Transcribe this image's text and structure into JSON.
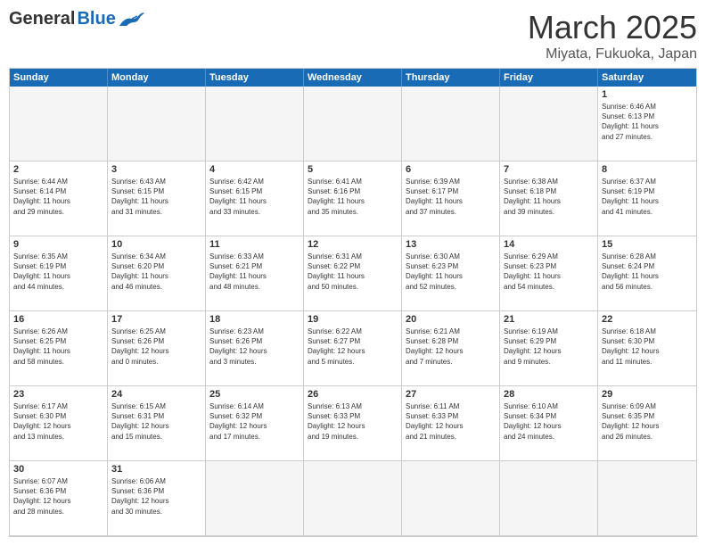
{
  "header": {
    "logo_general": "General",
    "logo_blue": "Blue",
    "title": "March 2025",
    "subtitle": "Miyata, Fukuoka, Japan"
  },
  "weekdays": [
    "Sunday",
    "Monday",
    "Tuesday",
    "Wednesday",
    "Thursday",
    "Friday",
    "Saturday"
  ],
  "weeks": [
    [
      {
        "day": "",
        "text": ""
      },
      {
        "day": "",
        "text": ""
      },
      {
        "day": "",
        "text": ""
      },
      {
        "day": "",
        "text": ""
      },
      {
        "day": "",
        "text": ""
      },
      {
        "day": "",
        "text": ""
      },
      {
        "day": "1",
        "text": "Sunrise: 6:46 AM\nSunset: 6:13 PM\nDaylight: 11 hours\nand 27 minutes."
      }
    ],
    [
      {
        "day": "2",
        "text": "Sunrise: 6:44 AM\nSunset: 6:14 PM\nDaylight: 11 hours\nand 29 minutes."
      },
      {
        "day": "3",
        "text": "Sunrise: 6:43 AM\nSunset: 6:15 PM\nDaylight: 11 hours\nand 31 minutes."
      },
      {
        "day": "4",
        "text": "Sunrise: 6:42 AM\nSunset: 6:15 PM\nDaylight: 11 hours\nand 33 minutes."
      },
      {
        "day": "5",
        "text": "Sunrise: 6:41 AM\nSunset: 6:16 PM\nDaylight: 11 hours\nand 35 minutes."
      },
      {
        "day": "6",
        "text": "Sunrise: 6:39 AM\nSunset: 6:17 PM\nDaylight: 11 hours\nand 37 minutes."
      },
      {
        "day": "7",
        "text": "Sunrise: 6:38 AM\nSunset: 6:18 PM\nDaylight: 11 hours\nand 39 minutes."
      },
      {
        "day": "8",
        "text": "Sunrise: 6:37 AM\nSunset: 6:19 PM\nDaylight: 11 hours\nand 41 minutes."
      }
    ],
    [
      {
        "day": "9",
        "text": "Sunrise: 6:35 AM\nSunset: 6:19 PM\nDaylight: 11 hours\nand 44 minutes."
      },
      {
        "day": "10",
        "text": "Sunrise: 6:34 AM\nSunset: 6:20 PM\nDaylight: 11 hours\nand 46 minutes."
      },
      {
        "day": "11",
        "text": "Sunrise: 6:33 AM\nSunset: 6:21 PM\nDaylight: 11 hours\nand 48 minutes."
      },
      {
        "day": "12",
        "text": "Sunrise: 6:31 AM\nSunset: 6:22 PM\nDaylight: 11 hours\nand 50 minutes."
      },
      {
        "day": "13",
        "text": "Sunrise: 6:30 AM\nSunset: 6:23 PM\nDaylight: 11 hours\nand 52 minutes."
      },
      {
        "day": "14",
        "text": "Sunrise: 6:29 AM\nSunset: 6:23 PM\nDaylight: 11 hours\nand 54 minutes."
      },
      {
        "day": "15",
        "text": "Sunrise: 6:28 AM\nSunset: 6:24 PM\nDaylight: 11 hours\nand 56 minutes."
      }
    ],
    [
      {
        "day": "16",
        "text": "Sunrise: 6:26 AM\nSunset: 6:25 PM\nDaylight: 11 hours\nand 58 minutes."
      },
      {
        "day": "17",
        "text": "Sunrise: 6:25 AM\nSunset: 6:26 PM\nDaylight: 12 hours\nand 0 minutes."
      },
      {
        "day": "18",
        "text": "Sunrise: 6:23 AM\nSunset: 6:26 PM\nDaylight: 12 hours\nand 3 minutes."
      },
      {
        "day": "19",
        "text": "Sunrise: 6:22 AM\nSunset: 6:27 PM\nDaylight: 12 hours\nand 5 minutes."
      },
      {
        "day": "20",
        "text": "Sunrise: 6:21 AM\nSunset: 6:28 PM\nDaylight: 12 hours\nand 7 minutes."
      },
      {
        "day": "21",
        "text": "Sunrise: 6:19 AM\nSunset: 6:29 PM\nDaylight: 12 hours\nand 9 minutes."
      },
      {
        "day": "22",
        "text": "Sunrise: 6:18 AM\nSunset: 6:30 PM\nDaylight: 12 hours\nand 11 minutes."
      }
    ],
    [
      {
        "day": "23",
        "text": "Sunrise: 6:17 AM\nSunset: 6:30 PM\nDaylight: 12 hours\nand 13 minutes."
      },
      {
        "day": "24",
        "text": "Sunrise: 6:15 AM\nSunset: 6:31 PM\nDaylight: 12 hours\nand 15 minutes."
      },
      {
        "day": "25",
        "text": "Sunrise: 6:14 AM\nSunset: 6:32 PM\nDaylight: 12 hours\nand 17 minutes."
      },
      {
        "day": "26",
        "text": "Sunrise: 6:13 AM\nSunset: 6:33 PM\nDaylight: 12 hours\nand 19 minutes."
      },
      {
        "day": "27",
        "text": "Sunrise: 6:11 AM\nSunset: 6:33 PM\nDaylight: 12 hours\nand 21 minutes."
      },
      {
        "day": "28",
        "text": "Sunrise: 6:10 AM\nSunset: 6:34 PM\nDaylight: 12 hours\nand 24 minutes."
      },
      {
        "day": "29",
        "text": "Sunrise: 6:09 AM\nSunset: 6:35 PM\nDaylight: 12 hours\nand 26 minutes."
      }
    ],
    [
      {
        "day": "30",
        "text": "Sunrise: 6:07 AM\nSunset: 6:36 PM\nDaylight: 12 hours\nand 28 minutes."
      },
      {
        "day": "31",
        "text": "Sunrise: 6:06 AM\nSunset: 6:36 PM\nDaylight: 12 hours\nand 30 minutes."
      },
      {
        "day": "",
        "text": ""
      },
      {
        "day": "",
        "text": ""
      },
      {
        "day": "",
        "text": ""
      },
      {
        "day": "",
        "text": ""
      },
      {
        "day": "",
        "text": ""
      }
    ]
  ]
}
